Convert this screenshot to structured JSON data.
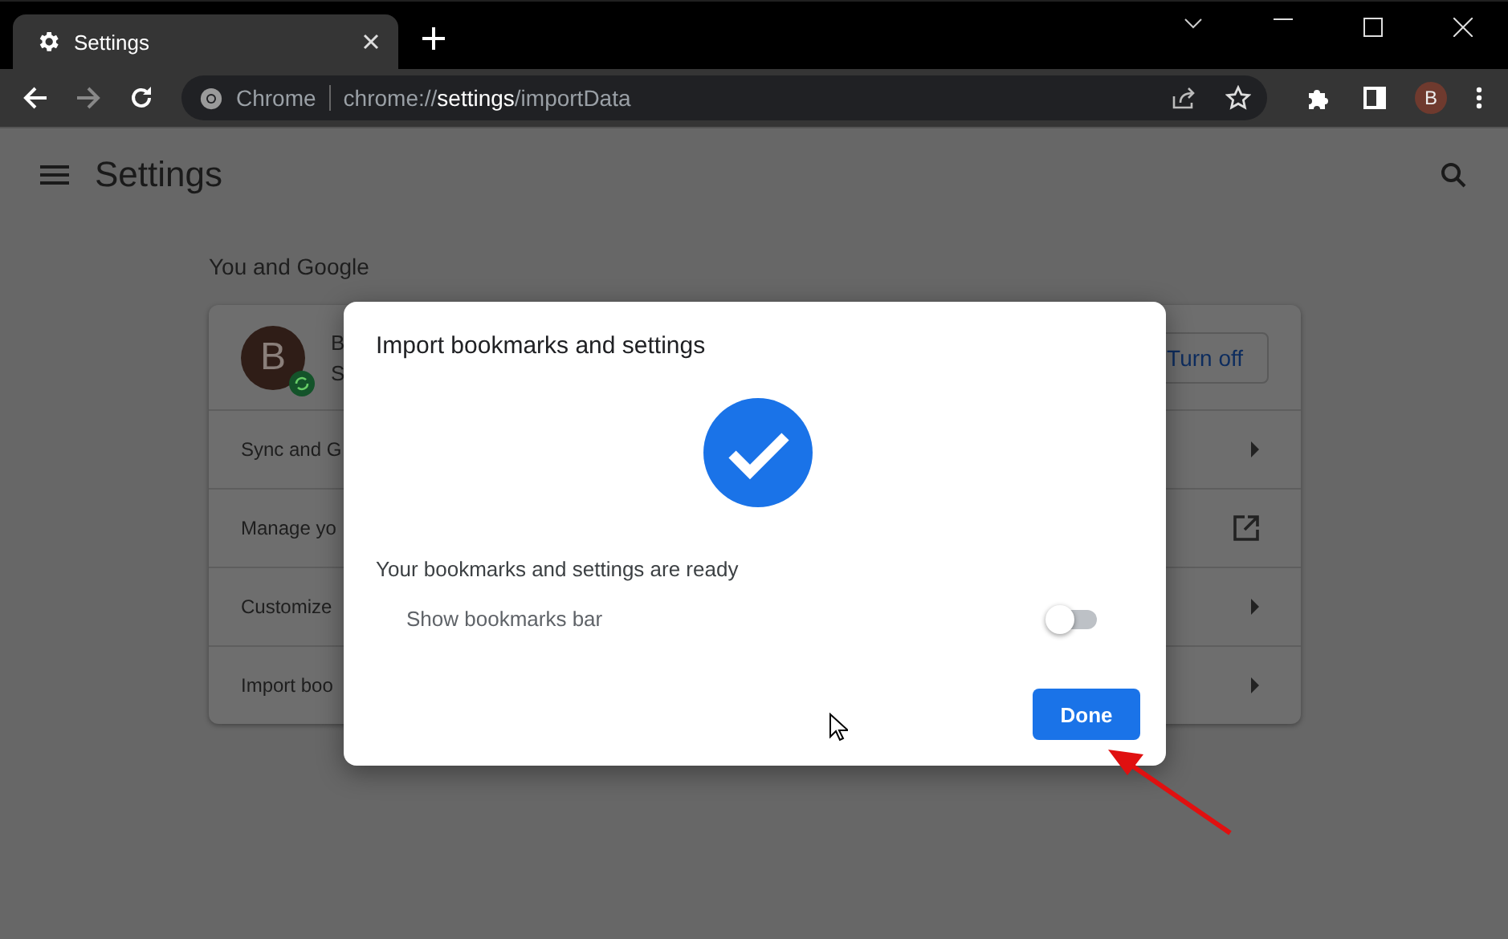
{
  "tab": {
    "title": "Settings",
    "selected": true
  },
  "address_bar": {
    "site_label": "Chrome",
    "url_scheme": "chrome://",
    "url_host": "settings",
    "url_path": "/importData"
  },
  "profile_button": {
    "initial": "B"
  },
  "page": {
    "title": "Settings",
    "section_title": "You and Google",
    "account": {
      "avatar_initial": "B",
      "name": "B",
      "status": "S",
      "button": "Turn off"
    },
    "rows": [
      {
        "label": "Sync and G",
        "kind": "submenu"
      },
      {
        "label": "Manage yo",
        "kind": "external"
      },
      {
        "label": "Customize",
        "kind": "submenu"
      },
      {
        "label": "Import boo",
        "kind": "submenu"
      }
    ]
  },
  "dialog": {
    "title": "Import bookmarks and settings",
    "message": "Your bookmarks and settings are ready",
    "toggle": {
      "label": "Show bookmarks bar",
      "on": false
    },
    "button": "Done"
  }
}
